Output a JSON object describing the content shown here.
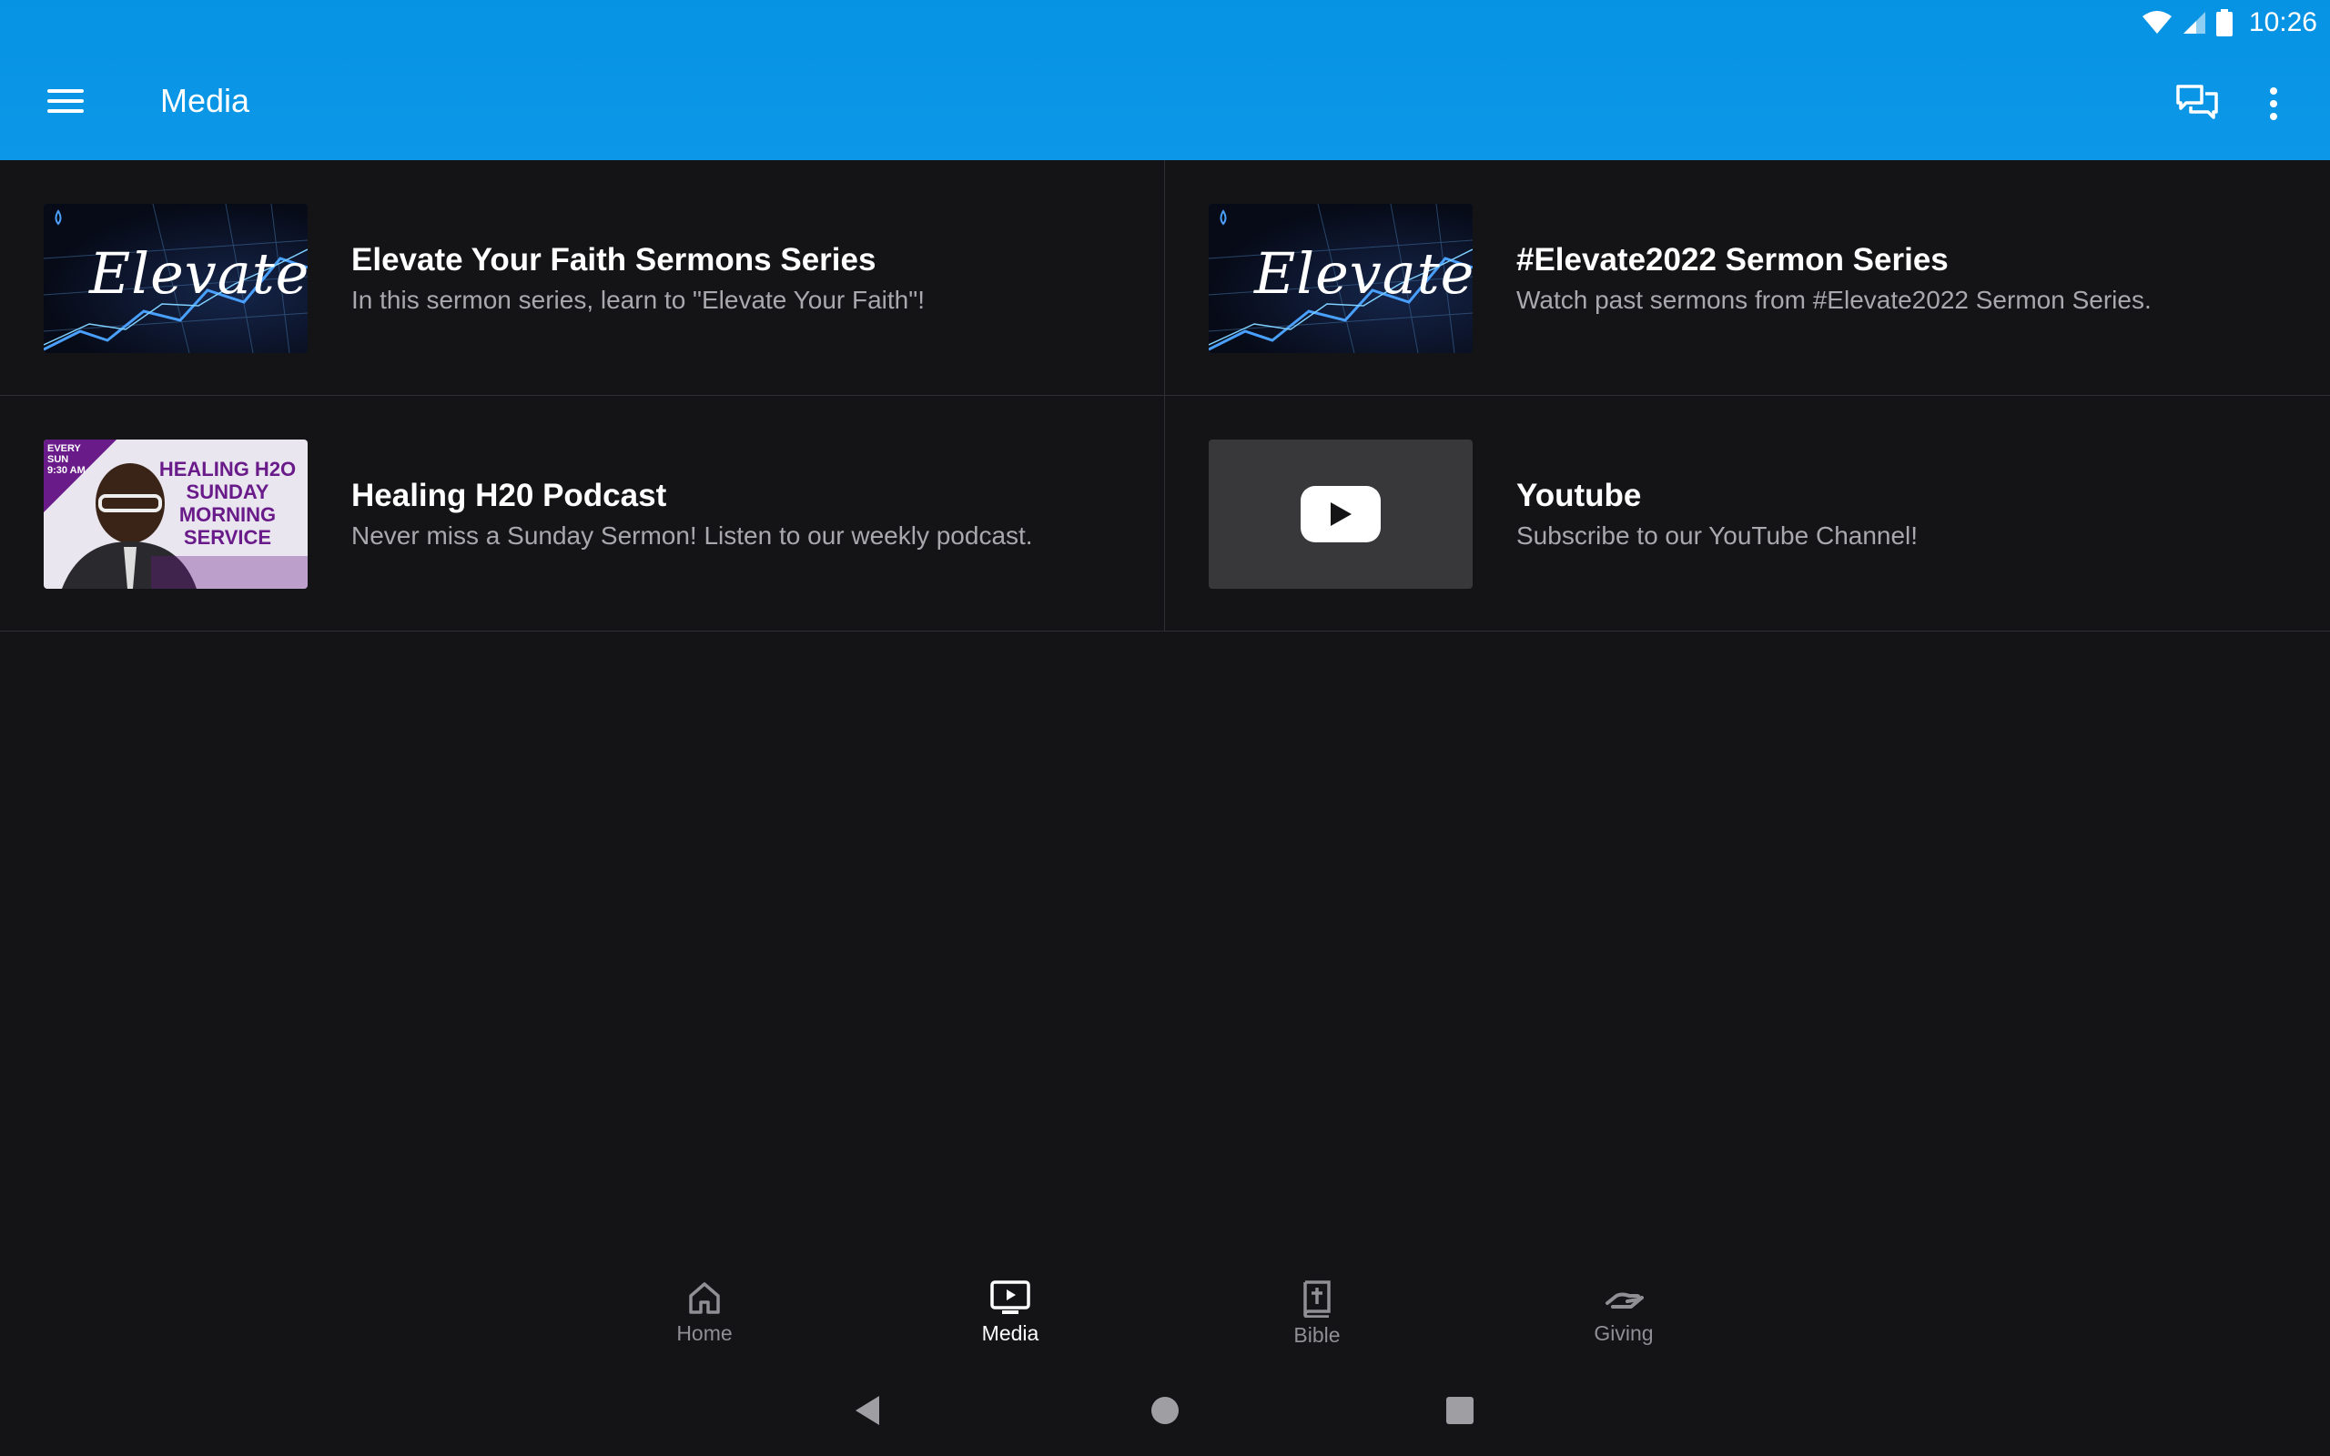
{
  "status_bar": {
    "time": "10:26"
  },
  "toolbar": {
    "title": "Media"
  },
  "media_items": [
    {
      "title": "Elevate Your Faith Sermons Series",
      "subtitle": "In this sermon series, learn to \"Elevate Your Faith\"!",
      "thumb_text": "Elevate"
    },
    {
      "title": "#Elevate2022 Sermon Series",
      "subtitle": "Watch past sermons from #Elevate2022 Sermon Series.",
      "thumb_text": "Elevate"
    },
    {
      "title": "Healing H20 Podcast",
      "subtitle": "Never miss a Sunday Sermon! Listen to our weekly podcast.",
      "thumb_text": "HEALING H2O SUNDAY MORNING SERVICE",
      "thumb_badge": "EVERY SUN 9:30 AM"
    },
    {
      "title": "Youtube",
      "subtitle": "Subscribe to our YouTube Channel!"
    }
  ],
  "bottom_nav": [
    {
      "label": "Home",
      "icon": "home-icon",
      "active": false
    },
    {
      "label": "Media",
      "icon": "tv-play-icon",
      "active": true
    },
    {
      "label": "Bible",
      "icon": "bible-icon",
      "active": false
    },
    {
      "label": "Giving",
      "icon": "giving-hand-icon",
      "active": false
    }
  ],
  "colors": {
    "app_bar": "#0693e3",
    "background": "#141417",
    "subtitle": "#a9a9ad",
    "nav_inactive": "#8f8f94"
  }
}
